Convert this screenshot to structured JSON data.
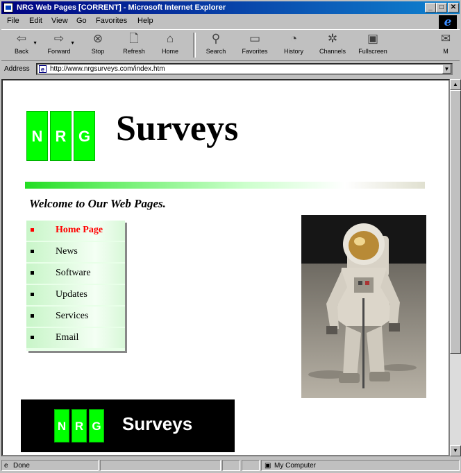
{
  "window": {
    "title": "NRG Web Pages [CORRENT] - Microsoft Internet Explorer"
  },
  "title_buttons": {
    "minimize": "_",
    "maximize": "□",
    "close": "✕"
  },
  "menu": [
    "File",
    "Edit",
    "View",
    "Go",
    "Favorites",
    "Help"
  ],
  "toolbar": {
    "buttons": [
      {
        "label": "Back",
        "icon": "back-arrow-icon"
      },
      {
        "label": "Forward",
        "icon": "forward-arrow-icon"
      },
      {
        "label": "Stop",
        "icon": "stop-icon"
      },
      {
        "label": "Refresh",
        "icon": "refresh-icon"
      },
      {
        "label": "Home",
        "icon": "home-icon"
      },
      {
        "label": "Search",
        "icon": "search-icon"
      },
      {
        "label": "Favorites",
        "icon": "favorites-icon"
      },
      {
        "label": "History",
        "icon": "history-icon"
      },
      {
        "label": "Channels",
        "icon": "channels-icon"
      },
      {
        "label": "Fullscreen",
        "icon": "fullscreen-icon"
      },
      {
        "label": "M",
        "icon": "mail-icon"
      }
    ]
  },
  "address": {
    "label": "Address",
    "url": "http://www.nrgsurveys.com/index.htm"
  },
  "page": {
    "logo_letters": [
      "N",
      "R",
      "G"
    ],
    "title": "Surveys",
    "welcome": "Welcome to Our Web Pages.",
    "nav": [
      {
        "label": "Home Page",
        "active": true
      },
      {
        "label": "News",
        "active": false
      },
      {
        "label": "Software",
        "active": false
      },
      {
        "label": "Updates",
        "active": false
      },
      {
        "label": "Services",
        "active": false
      },
      {
        "label": "Email",
        "active": false
      }
    ],
    "footer_title": "Surveys"
  },
  "status": {
    "text": "Done",
    "zone": "My Computer"
  },
  "colors": {
    "logo_green": "#00ff00",
    "title_bar": "#000080",
    "active_link": "#ff0000"
  }
}
